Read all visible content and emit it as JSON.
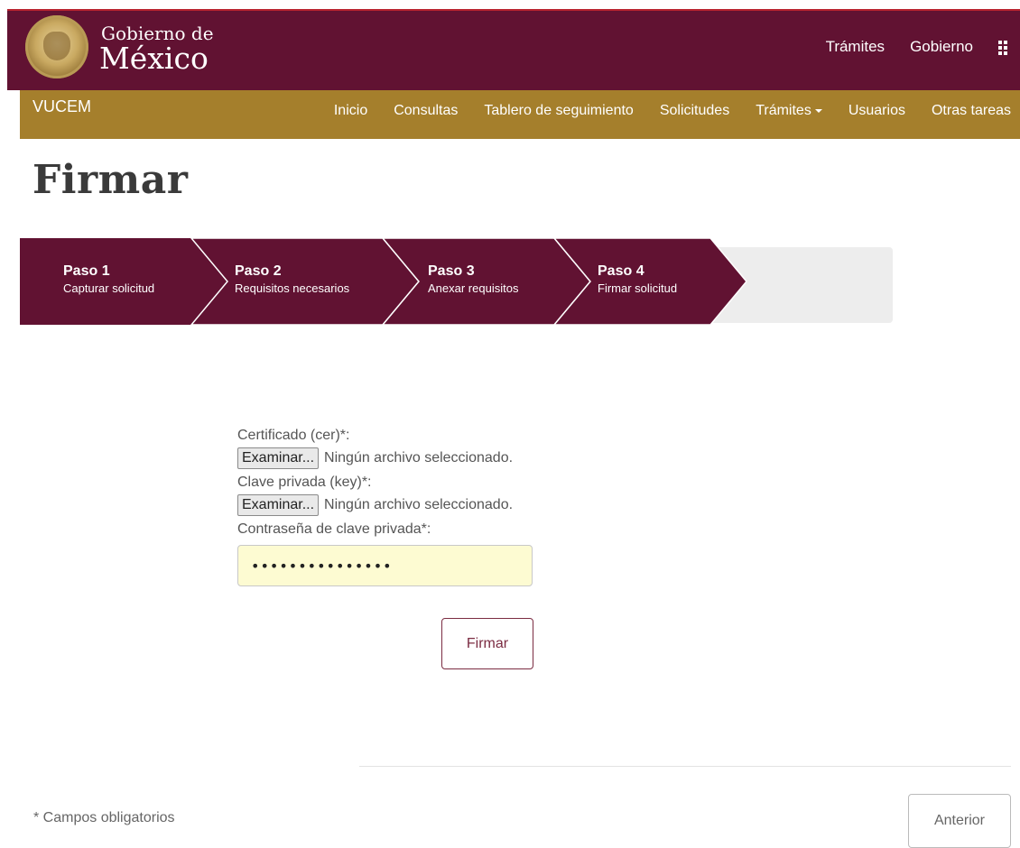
{
  "header": {
    "brand_line1": "Gobierno de",
    "brand_line2": "México",
    "nav": [
      "Trámites",
      "Gobierno"
    ],
    "logo_icon": "mexico-seal-icon",
    "apps_icon": "grid-icon",
    "colors": {
      "gob_bar": "#611232",
      "accent_line": "#b8232f"
    }
  },
  "subnav": {
    "brand": "VUCEM",
    "items": [
      "Inicio",
      "Consultas",
      "Tablero de seguimiento",
      "Solicitudes",
      "Trámites",
      "Usuarios",
      "Otras tareas"
    ],
    "colors": {
      "bar": "#a57f2c"
    }
  },
  "page": {
    "title": "Firmar"
  },
  "stepper": {
    "steps": [
      {
        "num": "Paso 1",
        "desc": "Capturar solicitud"
      },
      {
        "num": "Paso 2",
        "desc": "Requisitos necesarios"
      },
      {
        "num": "Paso 3",
        "desc": "Anexar requisitos"
      },
      {
        "num": "Paso 4",
        "desc": "Firmar solicitud"
      }
    ],
    "colors": {
      "step": "#611232",
      "track": "#ededed"
    }
  },
  "form": {
    "cert_label": "Certificado (cer)*:",
    "key_label": "Clave privada (key)*:",
    "browse_label": "Examinar...",
    "no_file": "Ningún archivo seleccionado.",
    "password_label": "Contraseña de clave privada*:",
    "password_value": "•••••••••••••••",
    "submit_label": "Firmar",
    "colors": {
      "password_bg": "#fdfbd2"
    }
  },
  "footer": {
    "required_note": "* Campos obligatorios",
    "prev_label": "Anterior"
  }
}
